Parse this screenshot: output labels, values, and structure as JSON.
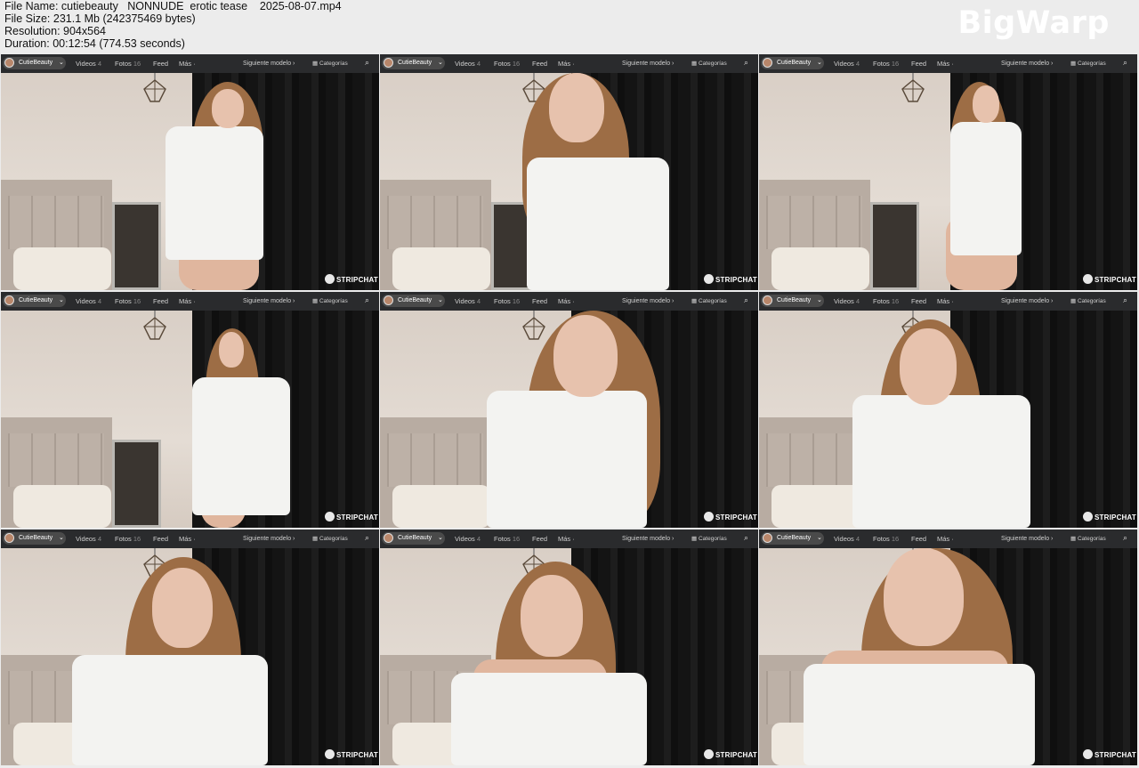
{
  "meta": {
    "file_name": "File Name: cutiebeauty   NONNUDE  erotic tease    2025-08-07.mp4",
    "file_size": "File Size: 231.1 Mb (242375469 bytes)",
    "resolution": "Resolution: 904x564",
    "duration": "Duration: 00:12:54 (774.53 seconds)"
  },
  "watermark": "BigWarp",
  "nav": {
    "model": "CutieBeauty",
    "videos": "Videos",
    "videos_count": "4",
    "fotos": "Fotos",
    "fotos_count": "16",
    "feed": "Feed",
    "mas": "Más",
    "next": "Siguiente modelo",
    "categories": "Categorías"
  },
  "brand": "STRIPCHAT",
  "thumbnails": [
    {
      "id": 1
    },
    {
      "id": 2
    },
    {
      "id": 3
    },
    {
      "id": 4
    },
    {
      "id": 5
    },
    {
      "id": 6
    },
    {
      "id": 7
    },
    {
      "id": 8
    },
    {
      "id": 9
    }
  ]
}
